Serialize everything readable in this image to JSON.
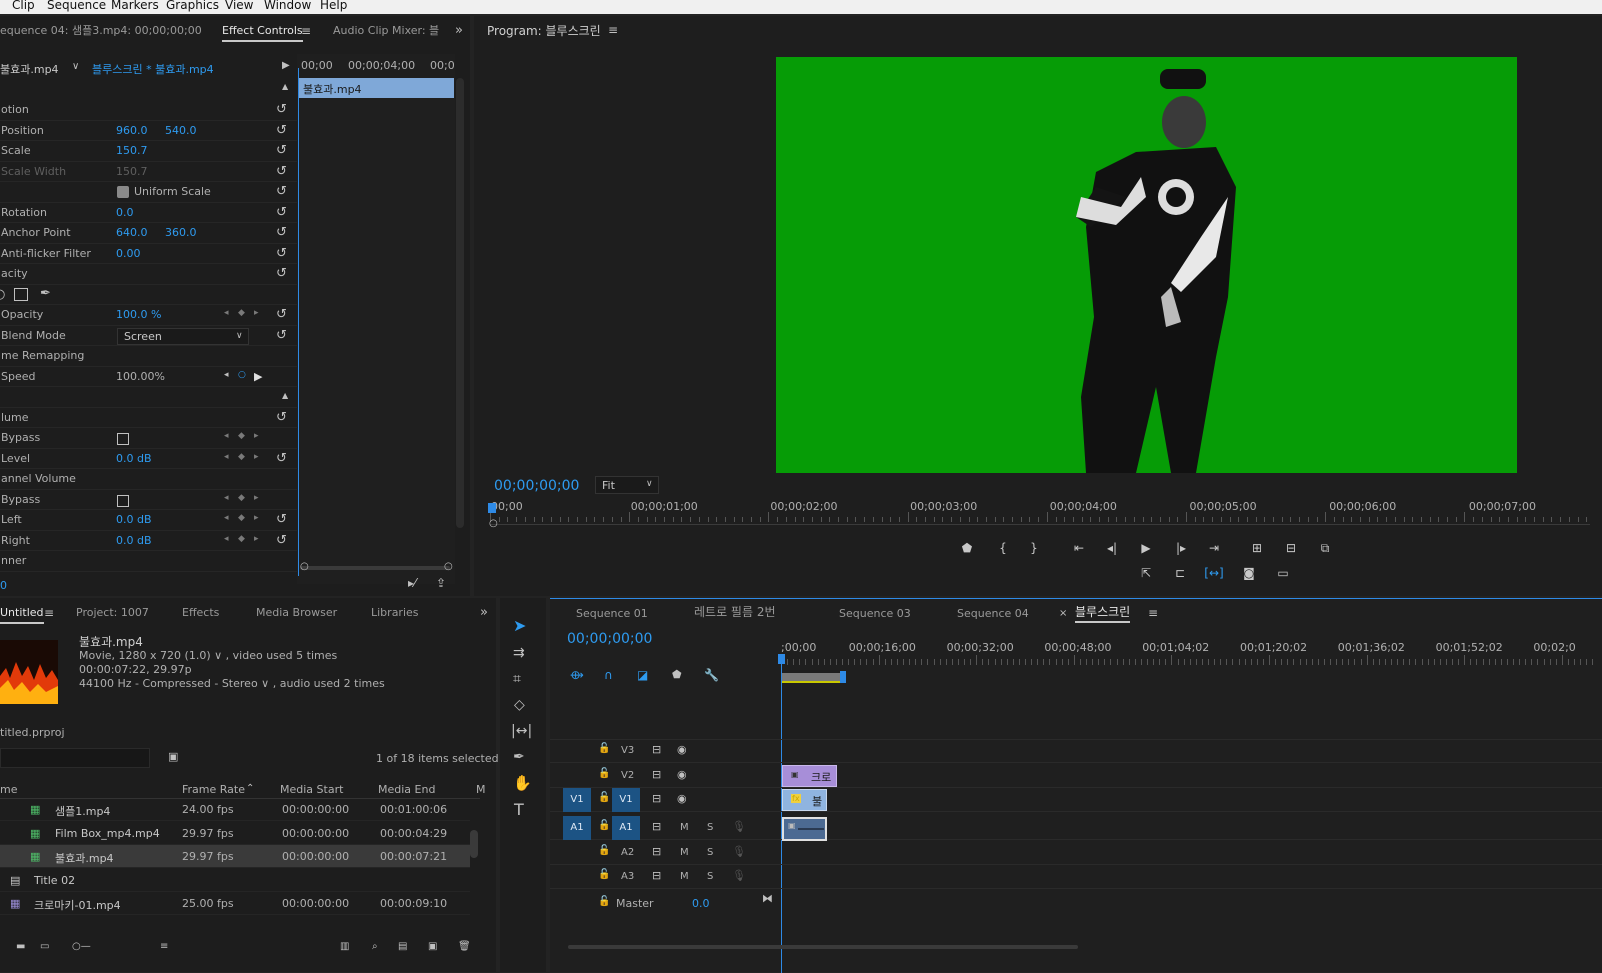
{
  "menu": [
    "Clip",
    "Sequence",
    "Markers",
    "Graphics",
    "View",
    "Window",
    "Help"
  ],
  "effect_controls": {
    "tabs": [
      "equence 04: 샘플3.mp4: 00;00;00;00",
      "Effect Controls",
      "Audio Clip Mixer: 블"
    ],
    "master_clip": "불효과.mp4",
    "sequence_clip": "블루스크린 * 불효과.mp4",
    "ruler": [
      "00;00",
      "00;00;04;00",
      "00;0"
    ],
    "clip_bar": "불효과.mp4",
    "rows": [
      {
        "label": "otion"
      },
      {
        "label": "Position",
        "v1": "960.0",
        "v2": "540.0"
      },
      {
        "label": "Scale",
        "v1": "150.7"
      },
      {
        "label": "Scale Width",
        "v1": "150.7",
        "disabled": true
      },
      {
        "label": "",
        "check": "Uniform Scale"
      },
      {
        "label": "Rotation",
        "v1": "0.0"
      },
      {
        "label": "Anchor Point",
        "v1": "640.0",
        "v2": "360.0"
      },
      {
        "label": "Anti-flicker Filter",
        "v1": "0.00"
      },
      {
        "label": "acity"
      },
      {
        "label": "",
        "shapes": true
      },
      {
        "label": "Opacity",
        "v1": "100.0 %"
      },
      {
        "label": "Blend Mode",
        "select": "Screen"
      },
      {
        "label": "me Remapping"
      },
      {
        "label": "Speed",
        "v1": "100.00%",
        "plain": true
      },
      {
        "label": ""
      },
      {
        "label": "lume"
      },
      {
        "label": "Bypass",
        "box": true
      },
      {
        "label": "Level",
        "v1": "0.0 dB"
      },
      {
        "label": "annel Volume"
      },
      {
        "label": "Bypass",
        "box": true
      },
      {
        "label": "Left",
        "v1": "0.0 dB"
      },
      {
        "label": "Right",
        "v1": "0.0 dB"
      },
      {
        "label": "nner"
      }
    ],
    "bottom_value": "0"
  },
  "program": {
    "title": "Program: 블루스크린",
    "timecode": "00;00;00;00",
    "fit": "Fit",
    "ruler": [
      "00;00",
      "00;00;01;00",
      "00;00;02;00",
      "00;00;03;00",
      "00;00;04;00",
      "00;00;05;00",
      "00;00;06;00",
      "00;00;07;00"
    ],
    "green": "#069c06"
  },
  "project": {
    "tabs": [
      "Untitled",
      "Project: 1007",
      "Effects",
      "Media Browser",
      "Libraries"
    ],
    "clip_name": "불효과.mp4",
    "info1": "Movie, 1280 x 720 (1.0) ∨ , video used 5 times",
    "info2": "00:00:07:22, 29.97p",
    "info3": "44100 Hz - Compressed - Stereo ∨ , audio used 2 times",
    "file": "titled.prproj",
    "count": "1 of 18 items selected",
    "columns": [
      "me",
      "Frame Rate",
      "Media Start",
      "Media End",
      "M"
    ],
    "items": [
      {
        "name": "샘플1.mp4",
        "rate": "24.00 fps",
        "start": "00:00:00:00",
        "end": "00:01:00:06"
      },
      {
        "name": "Film Box_mp4.mp4",
        "rate": "29.97 fps",
        "start": "00:00:00:00",
        "end": "00:00:04:29"
      },
      {
        "name": "불효과.mp4",
        "rate": "29.97 fps",
        "start": "00:00:00:00",
        "end": "00:00:07:21"
      },
      {
        "name": "Title 02",
        "rate": "",
        "start": "",
        "end": ""
      },
      {
        "name": "크로마키-01.mp4",
        "rate": "25.00 fps",
        "start": "00:00:00:00",
        "end": "00:00:09:10"
      }
    ]
  },
  "timeline": {
    "tabs": [
      "Sequence 01",
      "레트로 필름 2번",
      "Sequence 03",
      "Sequence 04",
      "블루스크린"
    ],
    "timecode": "00;00;00;00",
    "ruler": [
      ";00;00",
      "00;00;16;00",
      "00;00;32;00",
      "00;00;48;00",
      "00;01;04;02",
      "00;01;20;02",
      "00;01;36;02",
      "00;01;52;02",
      "00;02;0"
    ],
    "video_tracks": [
      "V3",
      "V2",
      "V1"
    ],
    "audio_tracks": [
      "A1",
      "A2",
      "A3"
    ],
    "src_v": "V1",
    "src_a": "A1",
    "m": "M",
    "s": "S",
    "master": "Master",
    "master_val": "0.0",
    "clip_v2": "크로",
    "clip_v1": "불",
    "clip_fx": "fx"
  }
}
